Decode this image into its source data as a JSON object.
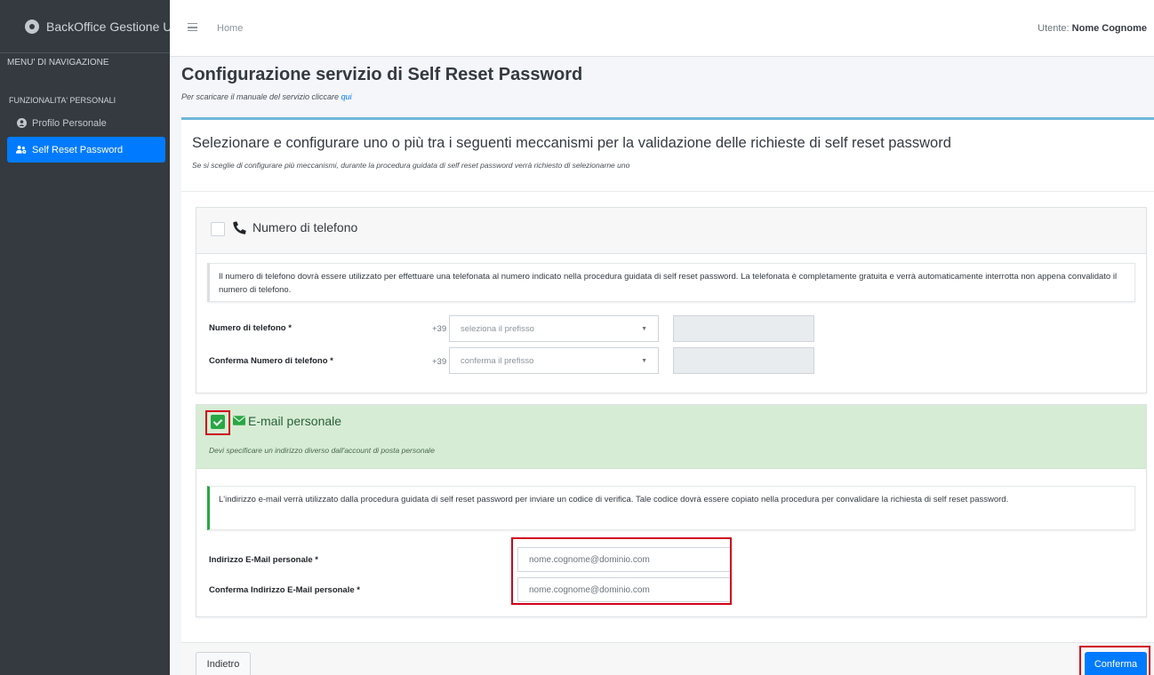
{
  "sidebar": {
    "brand": "BackOffice Gestione Utenti",
    "nav_header": "MENU' DI NAVIGAZIONE",
    "section_header": "FUNZIONALITA' PERSONALI",
    "items": [
      {
        "label": "Profilo Personale",
        "icon": "user-circle-icon"
      },
      {
        "label": "Self Reset Password",
        "icon": "users-cog-icon",
        "active": true
      }
    ]
  },
  "topbar": {
    "home": "Home",
    "user_prefix": "Utente:",
    "user_name": "Nome Cognome"
  },
  "header": {
    "title": "Configurazione servizio di Self Reset Password",
    "subtitle_text": "Per scaricare il manuale del servizio cliccare",
    "subtitle_link": "qui"
  },
  "main": {
    "title": "Selezionare e configurare uno o più tra i seguenti meccanismi per la validazione delle richieste di self reset password",
    "subtitle": "Se si sceglie di configurare più meccanismi, durante la procedura guidata di self reset password verrà richiesto di selezionarne uno"
  },
  "phone": {
    "title": "Numero di telefono",
    "checked": false,
    "description": "Il numero di telefono dovrà essere utilizzato per effettuare una telefonata al numero indicato nella procedura guidata di self reset password. La telefonata è completamente gratuita e verrà automaticamente interrotta non appena convalidato il numero di telefono.",
    "field1_label": "Numero di telefono *",
    "field2_label": "Conferma Numero di telefono *",
    "prefix": "+39",
    "select1_placeholder": "seleziona il prefisso",
    "select2_placeholder": "conferma il prefisso"
  },
  "email": {
    "title": "E-mail personale",
    "checked": true,
    "note": "Devi specificare un indirizzo diverso dall'account di posta personale",
    "description": "L'indirizzo e-mail verrà utilizzato dalla procedura guidata di self reset password per inviare un codice di verifica. Tale codice dovrà essere copiato nella procedura per convalidare la richiesta di self reset password.",
    "field1_label": "Indirizzo E-Mail personale *",
    "field2_label": "Conferma Indirizzo E-Mail personale *",
    "field1_value": "nome.cognome@dominio.com",
    "field2_value": "nome.cognome@dominio.com"
  },
  "footer": {
    "back_label": "Indietro",
    "confirm_label": "Conferma"
  },
  "colors": {
    "sidebar": "#343a40",
    "primary": "#007bff",
    "success": "#28a745",
    "highlight": "#d0021b"
  }
}
